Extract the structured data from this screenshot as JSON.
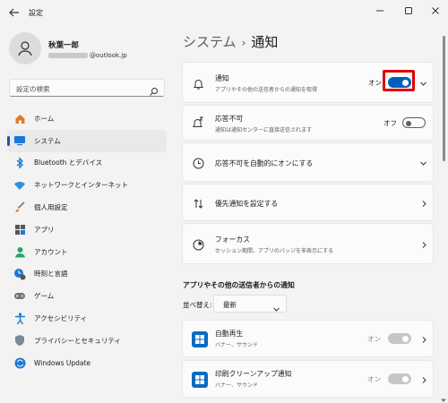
{
  "window": {
    "title": "設定"
  },
  "profile": {
    "name": "秋葉一郎",
    "email_domain": "@outlook.jp"
  },
  "search": {
    "placeholder": "設定の検索"
  },
  "nav": [
    {
      "label": "ホーム",
      "icon": "home-icon"
    },
    {
      "label": "システム",
      "icon": "system-icon",
      "active": true
    },
    {
      "label": "Bluetooth とデバイス",
      "icon": "bluetooth-icon"
    },
    {
      "label": "ネットワークとインターネット",
      "icon": "wifi-icon"
    },
    {
      "label": "個人用設定",
      "icon": "brush-icon"
    },
    {
      "label": "アプリ",
      "icon": "apps-icon"
    },
    {
      "label": "アカウント",
      "icon": "account-icon"
    },
    {
      "label": "時刻と言語",
      "icon": "time-language-icon"
    },
    {
      "label": "ゲーム",
      "icon": "gamepad-icon"
    },
    {
      "label": "アクセシビリティ",
      "icon": "accessibility-icon"
    },
    {
      "label": "プライバシーとセキュリティ",
      "icon": "shield-icon"
    },
    {
      "label": "Windows Update",
      "icon": "update-icon"
    }
  ],
  "breadcrumb": {
    "parent": "システム",
    "separator": "›",
    "current": "通知"
  },
  "cards": {
    "notifications": {
      "title": "通知",
      "sub": "アプリやその他の送信者からの通知を取得",
      "state": "オン"
    },
    "dnd": {
      "title": "応答不可",
      "sub": "通知は通知センターに直接送信されます",
      "state": "オフ"
    },
    "dnd_auto": {
      "title": "応答不可を自動的にオンにする"
    },
    "priority": {
      "title": "優先通知を設定する"
    },
    "focus": {
      "title": "フォーカス",
      "sub": "セッション期間、アプリのバッジを非表示にする"
    }
  },
  "apps_section": {
    "heading": "アプリやその他の送信者からの通知",
    "sort_label": "並べ替え:",
    "sort_value": "最新",
    "apps": [
      {
        "name": "自動再生",
        "sub": "バナー、サウンド",
        "state": "オン"
      },
      {
        "name": "印刷クリーンアップ通知",
        "sub": "バナー、サウンド",
        "state": "オン"
      }
    ]
  },
  "colors": {
    "accent": "#005fb8",
    "highlight": "#e00000"
  }
}
